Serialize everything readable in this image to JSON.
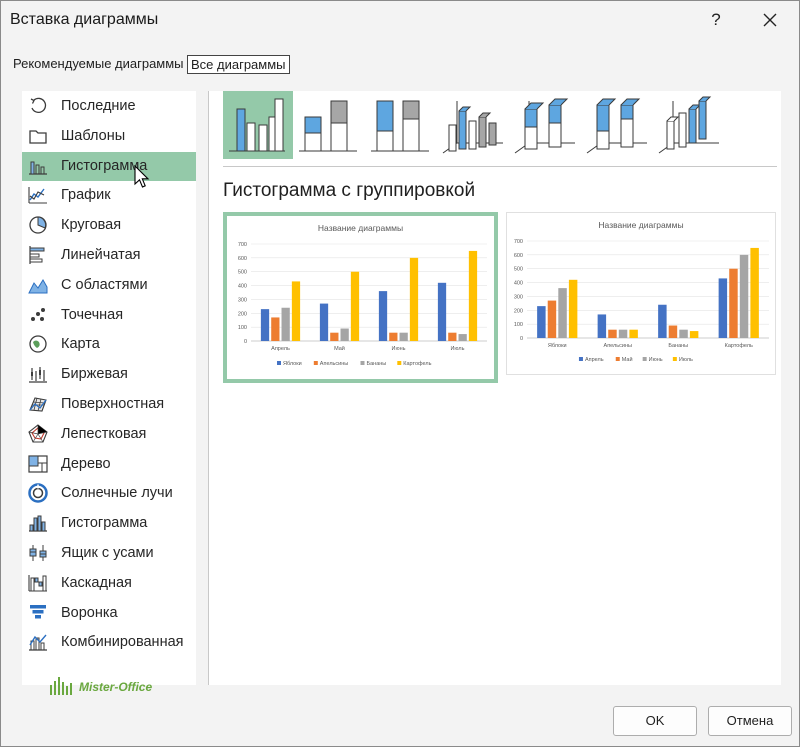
{
  "window": {
    "title": "Вставка диаграммы",
    "help": "?"
  },
  "tabs": [
    "Рекомендуемые диаграммы",
    "Все диаграммы"
  ],
  "sidebar": {
    "selected_index": 2,
    "items": [
      {
        "label": "Последние",
        "icon": "recent-icon"
      },
      {
        "label": "Шаблоны",
        "icon": "templates-icon"
      },
      {
        "label": "Гистограмма",
        "icon": "column-chart-icon"
      },
      {
        "label": "График",
        "icon": "line-chart-icon"
      },
      {
        "label": "Круговая",
        "icon": "pie-chart-icon"
      },
      {
        "label": "Линейчатая",
        "icon": "bar-chart-icon"
      },
      {
        "label": "С областями",
        "icon": "area-chart-icon"
      },
      {
        "label": "Точечная",
        "icon": "scatter-chart-icon"
      },
      {
        "label": "Карта",
        "icon": "map-chart-icon"
      },
      {
        "label": "Биржевая",
        "icon": "stock-chart-icon"
      },
      {
        "label": "Поверхностная",
        "icon": "surface-chart-icon"
      },
      {
        "label": "Лепестковая",
        "icon": "radar-chart-icon"
      },
      {
        "label": "Дерево",
        "icon": "treemap-chart-icon"
      },
      {
        "label": "Солнечные лучи",
        "icon": "sunburst-chart-icon"
      },
      {
        "label": "Гистограмма",
        "icon": "histogram-chart-icon"
      },
      {
        "label": "Ящик с усами",
        "icon": "box-whisker-chart-icon"
      },
      {
        "label": "Каскадная",
        "icon": "waterfall-chart-icon"
      },
      {
        "label": "Воронка",
        "icon": "funnel-chart-icon"
      },
      {
        "label": "Комбинированная",
        "icon": "combo-chart-icon"
      }
    ]
  },
  "logo": {
    "text": "Mister-Office"
  },
  "subtypes": [
    {
      "icon": "clustered-column-icon",
      "selected": true
    },
    {
      "icon": "stacked-column-icon"
    },
    {
      "icon": "100-stacked-column-icon"
    },
    {
      "icon": "3d-clustered-column-icon"
    },
    {
      "icon": "3d-stacked-column-icon"
    },
    {
      "icon": "3d-100-stacked-column-icon"
    },
    {
      "icon": "3d-column-icon"
    }
  ],
  "section_title": "Гистограмма с группировкой",
  "colors": {
    "blue": "#4472c4",
    "orange": "#ed7d31",
    "gray": "#a5a5a5",
    "yellow": "#ffc000",
    "selection": "#94c9a9"
  },
  "chart_data": [
    {
      "type": "bar",
      "title": "Название диаграммы",
      "ylim": [
        0,
        700
      ],
      "yticks": [
        "0",
        "100",
        "200",
        "300",
        "400",
        "500",
        "600",
        "700"
      ],
      "categories": [
        "Апрель",
        "Май",
        "Июнь",
        "Июль"
      ],
      "series": [
        {
          "name": "Яблоки",
          "values": [
            230,
            270,
            360,
            420
          ]
        },
        {
          "name": "Апельсины",
          "values": [
            170,
            60,
            60,
            60
          ]
        },
        {
          "name": "Бананы",
          "values": [
            240,
            90,
            60,
            50
          ]
        },
        {
          "name": "Картофель",
          "values": [
            430,
            500,
            600,
            650
          ]
        }
      ],
      "legend": "bottom",
      "grid": true
    },
    {
      "type": "bar",
      "title": "Название диаграммы",
      "ylim": [
        0,
        700
      ],
      "yticks": [
        "0",
        "100",
        "200",
        "300",
        "400",
        "500",
        "600",
        "700"
      ],
      "categories": [
        "Яблоки",
        "Апельсины",
        "Бананы",
        "Картофель"
      ],
      "series": [
        {
          "name": "Апрель",
          "values": [
            230,
            170,
            240,
            430
          ]
        },
        {
          "name": "Май",
          "values": [
            270,
            60,
            90,
            500
          ]
        },
        {
          "name": "Июнь",
          "values": [
            360,
            60,
            60,
            600
          ]
        },
        {
          "name": "Июль",
          "values": [
            420,
            60,
            50,
            650
          ]
        }
      ],
      "legend": "bottom",
      "grid": true
    }
  ],
  "buttons": {
    "ok": "OK",
    "cancel": "Отмена"
  }
}
